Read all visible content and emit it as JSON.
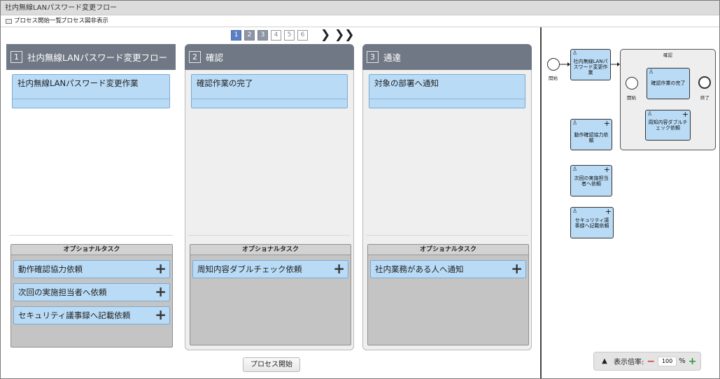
{
  "window": {
    "title": "社内無線LANパスワード変更フロー"
  },
  "toolbar": {
    "process_list": "プロセス開始一覧",
    "process_diagram": "プロセス図非表示"
  },
  "pager": {
    "pages": [
      "1",
      "2",
      "3",
      "4",
      "5",
      "6"
    ],
    "active": 1,
    "next": "❯",
    "last": "❯❯"
  },
  "columns": [
    {
      "num": "1",
      "title": "社内無線LANパスワード変更フロー",
      "task": "社内無線LANパスワード変更作業",
      "opt_title": "オプショナルタスク",
      "opt_items": [
        "動作確認協力依頼",
        "次回の実施担当者へ依頼",
        "セキュリティ議事録へ記載依頼"
      ]
    },
    {
      "num": "2",
      "title": "確認",
      "task": "確認作業の完了",
      "opt_title": "オプショナルタスク",
      "opt_items": [
        "周知内容ダブルチェック依頼"
      ]
    },
    {
      "num": "3",
      "title": "通達",
      "task": "対象の部署へ通知",
      "opt_title": "オプショナルタスク",
      "opt_items": [
        "社内業務がある人へ通知"
      ]
    }
  ],
  "start_button": "プロセス開始",
  "diagram": {
    "start_label": "開始",
    "main_task": "社内無線LANパスワード変更作業",
    "group_title": "確認",
    "group_start": "開始",
    "group_task": "確認作業の完了",
    "group_end": "終了",
    "group_opt": "周知内容ダブルチェック依頼",
    "opt_tasks": [
      "動作確認協力依頼",
      "次回の実施担当者へ依頼",
      "セキュリティ議事録へ記載依頼"
    ]
  },
  "zoom": {
    "label": "表示倍率:",
    "value": "100",
    "unit": "%"
  }
}
